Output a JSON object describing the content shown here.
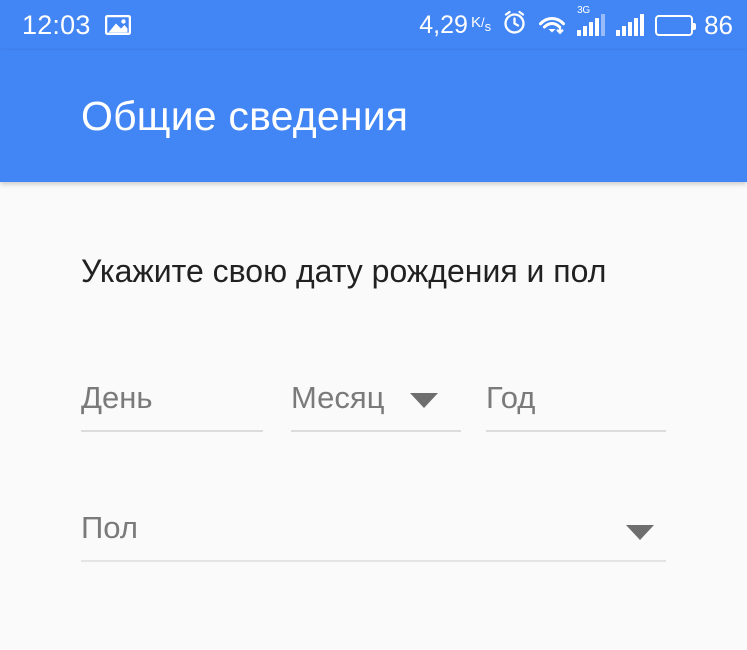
{
  "status_bar": {
    "time": "12:03",
    "screenshot_icon": "screenshot-icon",
    "network_speed_value": "4,29",
    "network_speed_unit_k": "K",
    "network_speed_unit_slash": "/",
    "network_speed_unit_s": "s",
    "alarm_icon": "alarm-clock-icon",
    "wifi_icon": "wifi-download-icon",
    "sim1_network_label": "3G",
    "sim1_icon": "signal-bars-icon",
    "sim2_icon": "signal-bars-icon",
    "battery_icon": "battery-icon",
    "battery_percent": "86",
    "background_color": "#4285f4",
    "foreground_color": "#ffffff"
  },
  "app_bar": {
    "title": "Общие сведения",
    "background_color": "#4285f4",
    "title_color": "#ffffff"
  },
  "form": {
    "subtitle": "Укажите свою дату рождения и пол",
    "subtitle_color": "#212121",
    "background_color": "#fafafa",
    "placeholder_color": "#7a7a7a",
    "underline_color": "#dcdcdc",
    "fields": [
      {
        "name": "day",
        "placeholder": "День",
        "value": "",
        "type": "text",
        "has_dropdown": false
      },
      {
        "name": "month",
        "placeholder": "Месяц",
        "value": "",
        "type": "select",
        "has_dropdown": true,
        "dropdown_icon": "chevron-down-icon"
      },
      {
        "name": "year",
        "placeholder": "Год",
        "value": "",
        "type": "text",
        "has_dropdown": false
      },
      {
        "name": "gender",
        "placeholder": "Пол",
        "value": "",
        "type": "select",
        "has_dropdown": true,
        "dropdown_icon": "chevron-down-icon"
      }
    ]
  }
}
